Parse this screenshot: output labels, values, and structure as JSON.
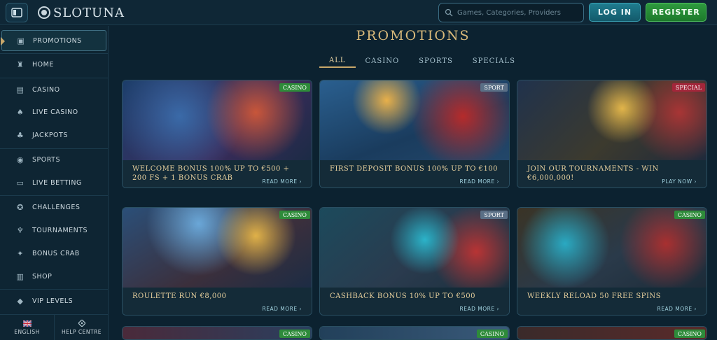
{
  "header": {
    "logo": "SLOTUNA",
    "search_placeholder": "Games, Categories, Providers",
    "login_label": "LOG IN",
    "register_label": "REGISTER"
  },
  "sidebar": {
    "items": [
      {
        "label": "PROMOTIONS",
        "icon": "chest-icon"
      },
      {
        "label": "HOME",
        "icon": "castle-icon"
      },
      {
        "label": "CASINO",
        "icon": "slot-machine-icon"
      },
      {
        "label": "LIVE CASINO",
        "icon": "cards-icon"
      },
      {
        "label": "JACKPOTS",
        "icon": "clover-icon"
      },
      {
        "label": "SPORTS",
        "icon": "ball-icon"
      },
      {
        "label": "LIVE BETTING",
        "icon": "live-icon"
      },
      {
        "label": "CHALLENGES",
        "icon": "medal-icon"
      },
      {
        "label": "TOURNAMENTS",
        "icon": "trophy-icon"
      },
      {
        "label": "BONUS CRAB",
        "icon": "crab-icon"
      },
      {
        "label": "SHOP",
        "icon": "bag-icon"
      },
      {
        "label": "VIP LEVELS",
        "icon": "diamond-icon"
      }
    ],
    "language": "ENGLISH",
    "help": "HELP CENTRE"
  },
  "main": {
    "title": "PROMOTIONS",
    "tabs": [
      "ALL",
      "CASINO",
      "SPORTS",
      "SPECIALS"
    ],
    "cards": [
      {
        "badge": "CASINO",
        "title": "WELCOME BONUS 100% UP TO €500 + 200 FS + 1 BONUS CRAB",
        "link": "READ MORE ›"
      },
      {
        "badge": "SPORT",
        "title": "FIRST DEPOSIT BONUS 100% UP TO €100",
        "link": "READ MORE ›"
      },
      {
        "badge": "SPECIAL",
        "title": "JOIN OUR TOURNAMENTS - WIN €6,000,000!",
        "link": "PLAY NOW ›"
      },
      {
        "badge": "CASINO",
        "title": "ROULETTE RUN €8,000",
        "link": "READ MORE ›"
      },
      {
        "badge": "SPORT",
        "title": "CASHBACK BONUS 10% UP TO €500",
        "link": "READ MORE ›"
      },
      {
        "badge": "CASINO",
        "title": "WEEKLY RELOAD 50 FREE SPINS",
        "link": "READ MORE ›"
      },
      {
        "badge": "CASINO"
      },
      {
        "badge": "CASINO"
      },
      {
        "badge": "CASINO"
      }
    ]
  },
  "colors": {
    "casino_badge": "#2e8b3a",
    "sport_badge": "#5a6f86",
    "special_badge": "#a3263a",
    "accent_gold": "#d9b97a"
  }
}
